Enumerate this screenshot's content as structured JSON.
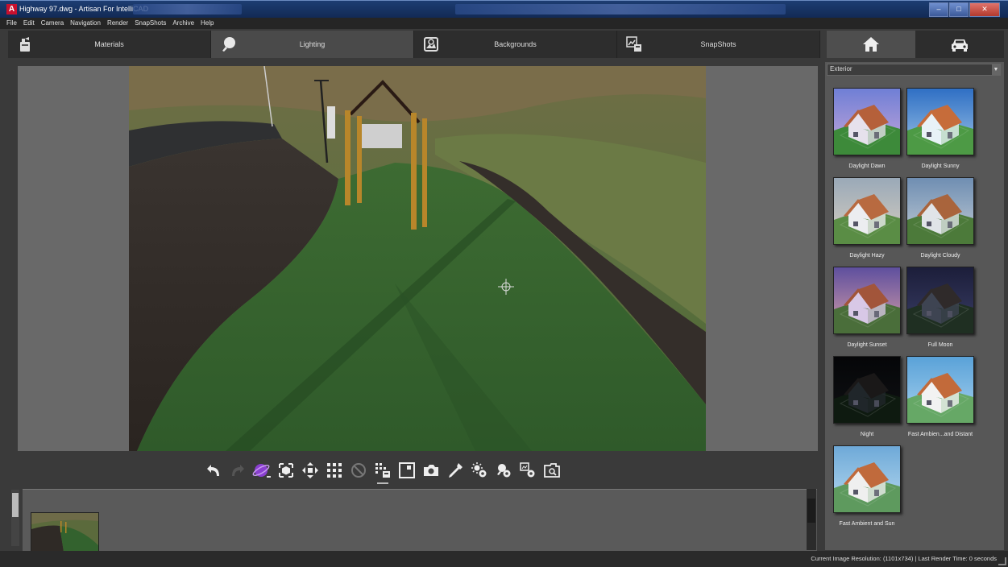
{
  "window": {
    "title": "Highway 97.dwg - Artisan For IntelliCAD"
  },
  "menu": [
    "File",
    "Edit",
    "Camera",
    "Navigation",
    "Render",
    "SnapShots",
    "Archive",
    "Help"
  ],
  "tabs": [
    {
      "label": "Materials",
      "icon": "paint-bucket-icon"
    },
    {
      "label": "Lighting",
      "icon": "light-bulb-icon",
      "active": true
    },
    {
      "label": "Backgrounds",
      "icon": "landscape-icon"
    },
    {
      "label": "SnapShots",
      "icon": "snapshot-icon"
    }
  ],
  "view_tabs": [
    {
      "icon": "house-icon",
      "active": true
    },
    {
      "icon": "car-icon"
    }
  ],
  "panel": {
    "category": "Exterior",
    "presets": [
      {
        "label": "Daylight Dawn",
        "sky": [
          "#6f7fd6",
          "#c9a7d9"
        ],
        "ground": "#3d8a3a",
        "wall": "#e6e1ec",
        "roof": "#b5603a"
      },
      {
        "label": "Daylight Sunny",
        "sky": [
          "#2f6fc4",
          "#9fc6e8"
        ],
        "ground": "#4d9a45",
        "wall": "#e8f2f7",
        "roof": "#c66c3a"
      },
      {
        "label": "Daylight Hazy",
        "sky": [
          "#9aa9b8",
          "#d8cfc0"
        ],
        "ground": "#5a8d45",
        "wall": "#ecedf0",
        "roof": "#b86a40"
      },
      {
        "label": "Daylight Cloudy",
        "sky": [
          "#6f8eb2",
          "#c3cdd6"
        ],
        "ground": "#4c7a3a",
        "wall": "#e0e4e8",
        "roof": "#a9643c"
      },
      {
        "label": "Daylight Sunset",
        "sky": [
          "#5e4f9e",
          "#d9a0a8"
        ],
        "ground": "#4a6e3a",
        "wall": "#d8c8e6",
        "roof": "#a2553a"
      },
      {
        "label": "Full Moon",
        "sky": [
          "#1c1e3a",
          "#3a3e66"
        ],
        "ground": "#1f2f22",
        "wall": "#3e4452",
        "roof": "#2f2a2a"
      },
      {
        "label": "Night",
        "sky": [
          "#050608",
          "#101114"
        ],
        "ground": "#0e1a10",
        "wall": "#20262a",
        "roof": "#1a1818"
      },
      {
        "label": "Fast Ambien...and Distant",
        "sky": [
          "#5aa2d8",
          "#a8d2ef"
        ],
        "ground": "#66a866",
        "wall": "#f2f2f2",
        "roof": "#c26a3a"
      },
      {
        "label": "Fast Ambient and Sun",
        "sky": [
          "#6ea9d8",
          "#b9dbf0"
        ],
        "ground": "#5e9a5e",
        "wall": "#efefef",
        "roof": "#c06a3c"
      }
    ]
  },
  "toolbar": {
    "tools": [
      "undo-icon",
      "redo-icon",
      "orbit-icon",
      "zoom-extents-icon",
      "pan-icon",
      "grid-icon",
      "cancel-icon",
      "render-options-icon",
      "safe-frame-icon",
      "snapshot-camera-icon",
      "eyedropper-icon",
      "sun-settings-icon",
      "light-settings-icon",
      "batch-render-icon",
      "image-viewer-icon"
    ]
  },
  "status": {
    "text": "Current Image Resolution: (1101x734)  |  Last Render Time: 0 seconds"
  }
}
